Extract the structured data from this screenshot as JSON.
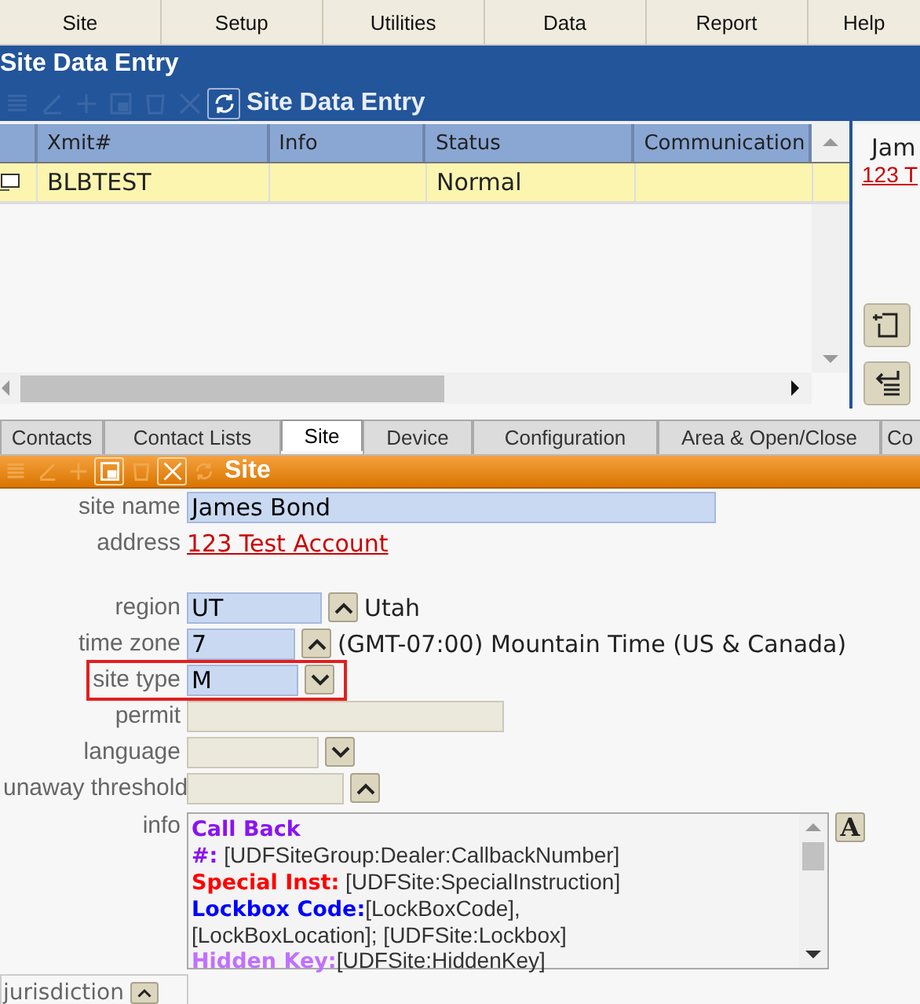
{
  "menu": [
    {
      "label": "Site"
    },
    {
      "label": "Setup"
    },
    {
      "label": "Utilities"
    },
    {
      "label": "Data"
    },
    {
      "label": "Report"
    },
    {
      "label": "Help"
    }
  ],
  "window": {
    "title": "Site Data Entry"
  },
  "list_panel": {
    "title": "Site Data Entry",
    "toolbar": [
      {
        "kind": "list",
        "disabled": true
      },
      {
        "kind": "edit",
        "disabled": true
      },
      {
        "kind": "add",
        "disabled": true
      },
      {
        "kind": "save",
        "disabled": true
      },
      {
        "kind": "delete",
        "disabled": true
      },
      {
        "kind": "cancel",
        "disabled": true
      },
      {
        "kind": "refresh",
        "disabled": false
      }
    ],
    "columns": [
      "Xmit#",
      "Info",
      "Status",
      "Communication"
    ],
    "rows": [
      {
        "selected": true,
        "cells": [
          "BLBTEST",
          "",
          "Normal",
          ""
        ]
      }
    ]
  },
  "side_panel": {
    "name": "Jam",
    "address": "123 T"
  },
  "tabs": [
    {
      "label": "Contacts",
      "selected": false
    },
    {
      "label": "Contact Lists",
      "selected": false
    },
    {
      "label": "Site",
      "selected": true
    },
    {
      "label": "Device",
      "selected": false
    },
    {
      "label": "Configuration",
      "selected": false
    },
    {
      "label": "Area & Open/Close",
      "selected": false
    },
    {
      "label": "Co",
      "selected": false
    }
  ],
  "site_panel": {
    "title": "Site",
    "toolbar": [
      {
        "kind": "list",
        "disabled": true
      },
      {
        "kind": "edit",
        "disabled": true
      },
      {
        "kind": "add",
        "disabled": true
      },
      {
        "kind": "save",
        "disabled": false
      },
      {
        "kind": "delete",
        "disabled": true
      },
      {
        "kind": "cancel",
        "disabled": false
      },
      {
        "kind": "refresh",
        "disabled": true
      }
    ],
    "fields": [
      {
        "label": "site name",
        "kind": "text",
        "value": "James Bond",
        "disabled": false,
        "highlighted": false
      },
      {
        "label": "address",
        "kind": "link",
        "value": "123 Test Account",
        "highlighted": false
      },
      {
        "label": "region",
        "kind": "lookup",
        "value": "UT",
        "description": "Utah",
        "disabled": false,
        "highlighted": false
      },
      {
        "label": "time zone",
        "kind": "lookup",
        "value": "7",
        "description": "(GMT-07:00) Mountain Time (US & Canada)",
        "disabled": false,
        "highlighted": false
      },
      {
        "label": "site type",
        "kind": "dropdown",
        "value": "M",
        "disabled": false,
        "highlighted": true
      },
      {
        "label": "permit",
        "kind": "text",
        "disabled": true,
        "highlighted": false
      },
      {
        "label": "language",
        "kind": "dropdown",
        "disabled": true,
        "highlighted": false
      },
      {
        "label": "unaway threshold",
        "kind": "lookup",
        "disabled": true,
        "highlighted": false
      },
      {
        "label": "info",
        "kind": "memo",
        "highlighted": false,
        "button": "A",
        "lines": [
          {
            "label": "Call Back",
            "color": "#8a14f0"
          },
          {
            "label": "#:",
            "text": " [UDFSiteGroup:Dealer:CallbackNumber]",
            "color": "#8a14f0"
          },
          {
            "label": "Special Inst:",
            "text": " [UDFSite:SpecialInstruction]",
            "color": "#ff0000"
          },
          {
            "label": "Lockbox Code:",
            "text": "[LockBoxCode],",
            "color": "#0000ff"
          },
          {
            "text": "[LockBoxLocation]; [UDFSite:Lockbox]"
          },
          {
            "label": "Hidden Key:",
            "text": "[UDFSite:HiddenKey]",
            "color": "#c070ff"
          }
        ]
      }
    ],
    "jurisdiction": {
      "label": "jurisdiction"
    }
  }
}
